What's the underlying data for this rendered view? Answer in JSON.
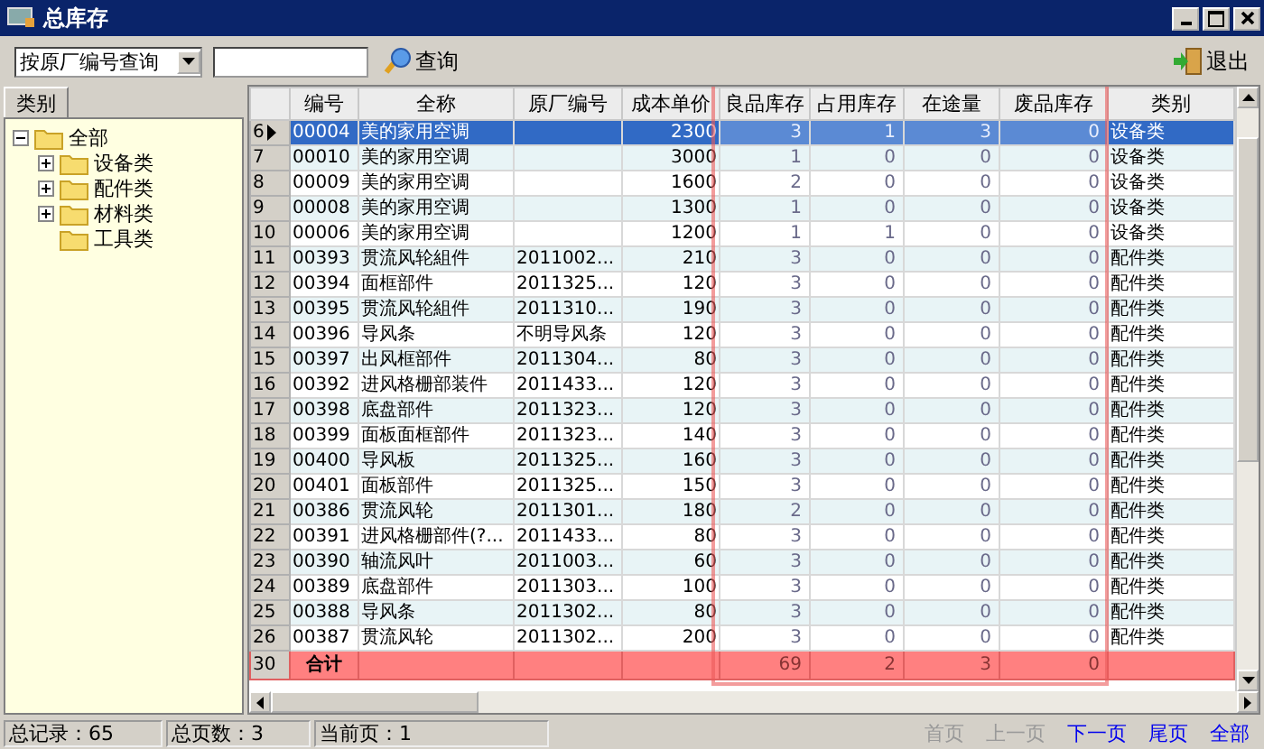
{
  "window": {
    "title": "总库存"
  },
  "toolbar": {
    "search_mode": "按原厂编号查询",
    "query_button": "查询",
    "exit_button": "退出"
  },
  "sidebar": {
    "tab": "类别",
    "tree": [
      {
        "label": "全部",
        "kind": "group",
        "expanded": true,
        "children": [
          {
            "label": "设备类",
            "kind": "group",
            "expanded": false
          },
          {
            "label": "配件类",
            "kind": "group",
            "expanded": false
          },
          {
            "label": "材料类",
            "kind": "group",
            "expanded": false
          },
          {
            "label": "工具类",
            "kind": "leaf",
            "expanded": false
          }
        ]
      }
    ]
  },
  "table": {
    "columns": [
      "编号",
      "全称",
      "原厂编号",
      "成本单价",
      "良品库存",
      "占用库存",
      "在途量",
      "废品库存",
      "类别"
    ],
    "rows": [
      {
        "row": "6",
        "selected": true,
        "cells": [
          "00004",
          "美的家用空调",
          "",
          "2300",
          "3",
          "1",
          "3",
          "0",
          "设备类"
        ]
      },
      {
        "row": "7",
        "selected": false,
        "cells": [
          "00010",
          "美的家用空调",
          "",
          "3000",
          "1",
          "0",
          "0",
          "0",
          "设备类"
        ]
      },
      {
        "row": "8",
        "selected": false,
        "cells": [
          "00009",
          "美的家用空调",
          "",
          "1600",
          "2",
          "0",
          "0",
          "0",
          "设备类"
        ]
      },
      {
        "row": "9",
        "selected": false,
        "cells": [
          "00008",
          "美的家用空调",
          "",
          "1300",
          "1",
          "0",
          "0",
          "0",
          "设备类"
        ]
      },
      {
        "row": "10",
        "selected": false,
        "cells": [
          "00006",
          "美的家用空调",
          "",
          "1200",
          "1",
          "1",
          "0",
          "0",
          "设备类"
        ]
      },
      {
        "row": "11",
        "selected": false,
        "cells": [
          "00393",
          "贯流风轮組件",
          "2011002...",
          "210",
          "3",
          "0",
          "0",
          "0",
          "配件类"
        ]
      },
      {
        "row": "12",
        "selected": false,
        "cells": [
          "00394",
          "面框部件",
          "2011325...",
          "120",
          "3",
          "0",
          "0",
          "0",
          "配件类"
        ]
      },
      {
        "row": "13",
        "selected": false,
        "cells": [
          "00395",
          "贯流风轮組件",
          "2011310...",
          "190",
          "3",
          "0",
          "0",
          "0",
          "配件类"
        ]
      },
      {
        "row": "14",
        "selected": false,
        "cells": [
          "00396",
          "导风条",
          "不明导风条",
          "120",
          "3",
          "0",
          "0",
          "0",
          "配件类"
        ]
      },
      {
        "row": "15",
        "selected": false,
        "cells": [
          "00397",
          "出风框部件",
          "2011304...",
          "80",
          "3",
          "0",
          "0",
          "0",
          "配件类"
        ]
      },
      {
        "row": "16",
        "selected": false,
        "cells": [
          "00392",
          "进风格栅部装件",
          "2011433...",
          "120",
          "3",
          "0",
          "0",
          "0",
          "配件类"
        ]
      },
      {
        "row": "17",
        "selected": false,
        "cells": [
          "00398",
          "底盘部件",
          "2011323...",
          "120",
          "3",
          "0",
          "0",
          "0",
          "配件类"
        ]
      },
      {
        "row": "18",
        "selected": false,
        "cells": [
          "00399",
          "面板面框部件",
          "2011323...",
          "140",
          "3",
          "0",
          "0",
          "0",
          "配件类"
        ]
      },
      {
        "row": "19",
        "selected": false,
        "cells": [
          "00400",
          "导风板",
          "2011325...",
          "160",
          "3",
          "0",
          "0",
          "0",
          "配件类"
        ]
      },
      {
        "row": "20",
        "selected": false,
        "cells": [
          "00401",
          "面板部件",
          "2011325...",
          "150",
          "3",
          "0",
          "0",
          "0",
          "配件类"
        ]
      },
      {
        "row": "21",
        "selected": false,
        "cells": [
          "00386",
          "贯流风轮",
          "2011301...",
          "180",
          "2",
          "0",
          "0",
          "0",
          "配件类"
        ]
      },
      {
        "row": "22",
        "selected": false,
        "cells": [
          "00391",
          "进风格栅部件(?...",
          "2011433...",
          "80",
          "3",
          "0",
          "0",
          "0",
          "配件类"
        ]
      },
      {
        "row": "23",
        "selected": false,
        "cells": [
          "00390",
          "轴流风叶",
          "2011003...",
          "60",
          "3",
          "0",
          "0",
          "0",
          "配件类"
        ]
      },
      {
        "row": "24",
        "selected": false,
        "cells": [
          "00389",
          "底盘部件",
          "2011303...",
          "100",
          "3",
          "0",
          "0",
          "0",
          "配件类"
        ]
      },
      {
        "row": "25",
        "selected": false,
        "cells": [
          "00388",
          "导风条",
          "2011302...",
          "80",
          "3",
          "0",
          "0",
          "0",
          "配件类"
        ]
      },
      {
        "row": "26",
        "selected": false,
        "cells": [
          "00387",
          "贯流风轮",
          "2011302...",
          "200",
          "3",
          "0",
          "0",
          "0",
          "配件类"
        ]
      }
    ],
    "totals": {
      "row": "30",
      "label": "合计",
      "cells": [
        "",
        "",
        "",
        "69",
        "2",
        "3",
        "0",
        ""
      ]
    }
  },
  "status_bar": {
    "records": "总记录：65",
    "pages": "总页数：3",
    "current": "当前页：1"
  },
  "pager": [
    {
      "label": "首页",
      "disabled": true
    },
    {
      "label": "上一页",
      "disabled": true
    },
    {
      "label": "下一页",
      "disabled": false
    },
    {
      "label": "尾页",
      "disabled": false
    },
    {
      "label": "全部",
      "disabled": false
    }
  ]
}
